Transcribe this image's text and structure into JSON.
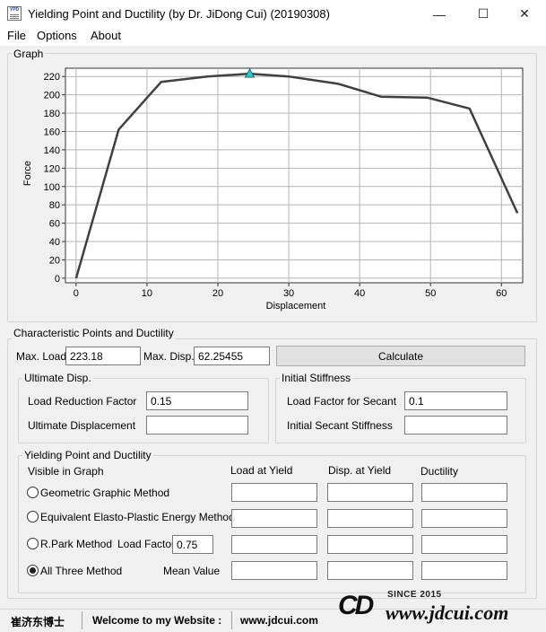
{
  "window": {
    "title": "Yielding Point and Ductility (by Dr. JiDong Cui) (20190308)",
    "icon_text": "YPD",
    "controls": {
      "minimize": "—",
      "maximize": "☐",
      "close": "✕"
    }
  },
  "menu": {
    "items": [
      "File",
      "Options",
      "About"
    ]
  },
  "graph_group": {
    "label": "Graph"
  },
  "chart_data": {
    "type": "line",
    "xlabel": "Displacement",
    "ylabel": "Force",
    "xlim": [
      -1.5,
      63
    ],
    "ylim": [
      -5,
      229
    ],
    "x_ticks": [
      0,
      10,
      20,
      30,
      40,
      50,
      60
    ],
    "y_ticks": [
      0,
      20,
      40,
      60,
      80,
      100,
      120,
      140,
      160,
      180,
      200,
      220
    ],
    "grid": true,
    "line_color": "#404040",
    "marker_color": "#2fc8c8",
    "series": [
      {
        "x": [
          0,
          6,
          12,
          18.5,
          24.5,
          30,
          37,
          43,
          49.5,
          55.5,
          62.25
        ],
        "y": [
          0,
          162,
          214,
          220,
          223,
          220,
          212,
          198,
          197,
          185,
          71
        ]
      }
    ],
    "peak_marker": {
      "x": 24.5,
      "y": 223.18
    }
  },
  "characteristic": {
    "label": "Characteristic Points and Ductility",
    "max_load_label": "Max. Load",
    "max_load_value": "223.18",
    "max_disp_label": "Max. Disp.",
    "max_disp_value": "62.25455",
    "calculate_label": "Calculate"
  },
  "ultimate": {
    "label": "Ultimate Disp.",
    "reduction_label": "Load Reduction Factor",
    "reduction_value": "0.15",
    "displacement_label": "Ultimate Displacement",
    "displacement_value": ""
  },
  "initial": {
    "label": "Initial Stiffness",
    "secant_factor_label": "Load Factor for Secant",
    "secant_factor_value": "0.1",
    "secant_stiffness_label": "Initial Secant Stiffness",
    "secant_stiffness_value": ""
  },
  "yielding": {
    "label": "Yielding Point and Ductility",
    "visible_label": "Visible in Graph",
    "col_load": "Load at Yield",
    "col_disp": "Disp. at Yield",
    "col_ductility": "Ductility",
    "methods": [
      {
        "label": "Geometric Graphic Method",
        "checked": false
      },
      {
        "label": "Equivalent Elasto-Plastic Energy Method",
        "checked": false
      },
      {
        "label": "R.Park Method",
        "checked": false
      },
      {
        "label": "All Three Method",
        "checked": true
      }
    ],
    "load_factor_label": "Load Factor",
    "load_factor_value": "0.75",
    "mean_value_label": "Mean Value"
  },
  "status": {
    "author": "崔济东博士",
    "welcome": "Welcome to my Website :",
    "website": "www.jdcui.com"
  },
  "logo": {
    "since": "SINCE 2015",
    "brand": "CD",
    "url": "www.jdcui.com"
  }
}
